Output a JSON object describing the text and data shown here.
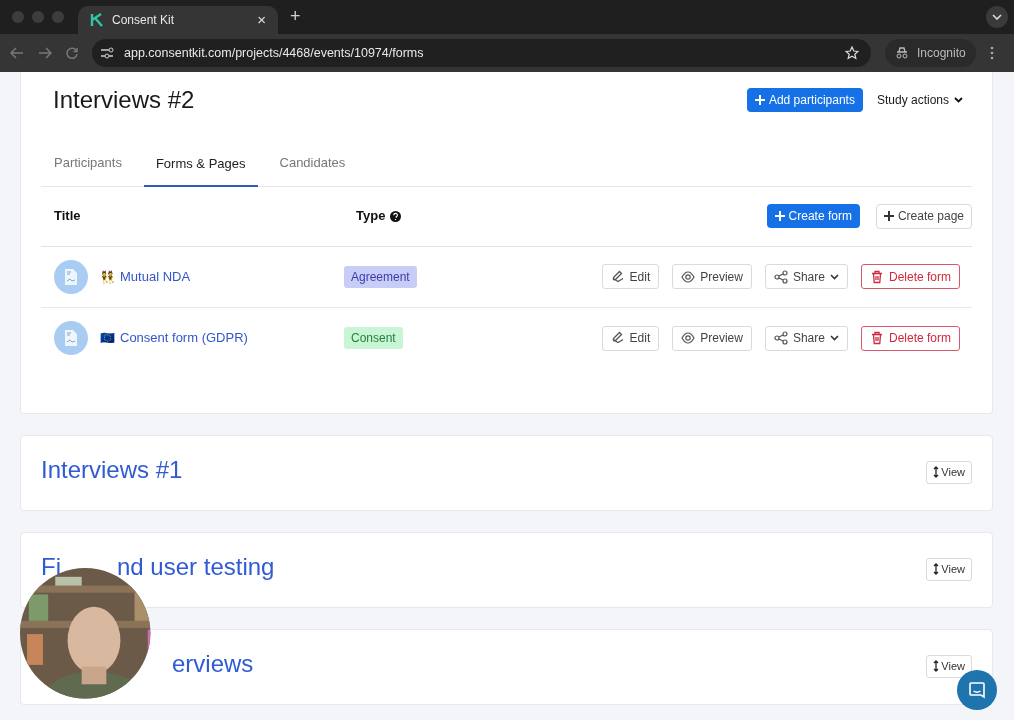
{
  "browser": {
    "tab_title": "Consent Kit",
    "tab_close": "×",
    "new_tab": "+",
    "url": "app.consentkit.com/projects/4468/events/10974/forms",
    "incognito": "Incognito"
  },
  "study": {
    "title": "Interviews #2",
    "add_button": "Add participants",
    "actions_menu": "Study actions",
    "tabs": [
      {
        "label": "Participants",
        "selected": false
      },
      {
        "label": "Forms & Pages",
        "selected": true
      },
      {
        "label": "Candidates",
        "selected": false
      }
    ],
    "table": {
      "columns": [
        "Title",
        "Type"
      ],
      "create_form": "Create form",
      "create_page": "Create page",
      "rows": [
        {
          "emoji": "👯",
          "title": "Mutual NDA",
          "type": "Agreement",
          "color": "#c7cdf7",
          "actions": [
            "Edit",
            "Preview",
            "Share",
            "Delete form"
          ]
        },
        {
          "emoji": "🇪🇺",
          "title": "Consent form (GDPR)",
          "type": "Consent",
          "color": "#c8f5d4",
          "actions": [
            "Edit",
            "Preview",
            "Share",
            "Delete form"
          ]
        }
      ]
    }
  },
  "other_studies": [
    {
      "title_parts": [
        "Interviews #1"
      ],
      "view": "View"
    },
    {
      "title_parts": [
        "Fi",
        "nd user testing"
      ],
      "view": "View"
    },
    {
      "title_parts": [
        "erviews"
      ],
      "view": "View"
    }
  ]
}
